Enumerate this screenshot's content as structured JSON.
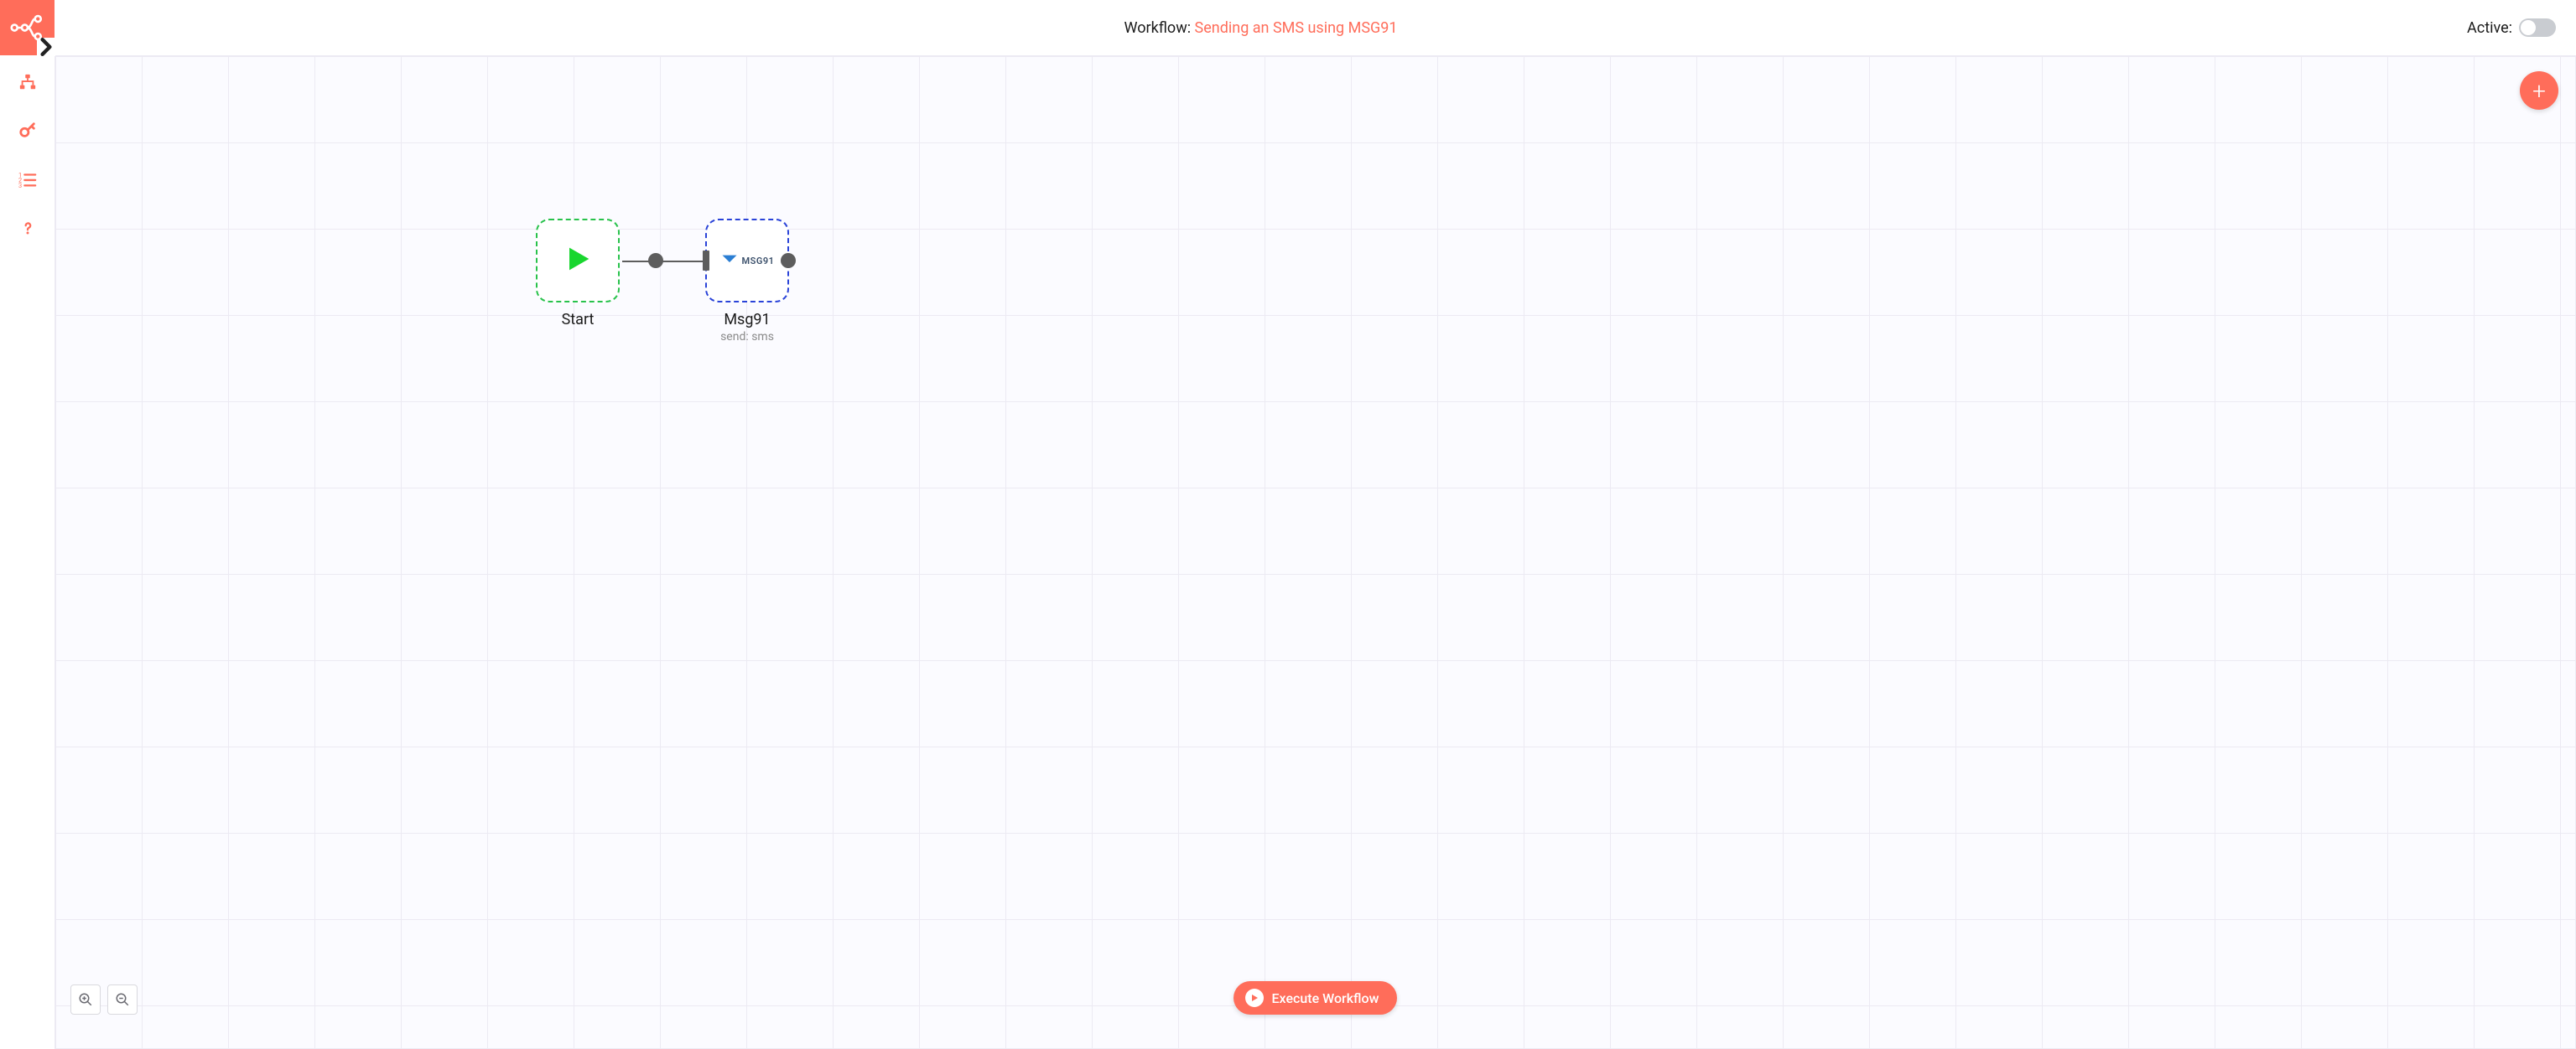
{
  "header": {
    "title_prefix": "Workflow: ",
    "workflow_name": "Sending an SMS using MSG91",
    "active_label": "Active:"
  },
  "sidebar": {
    "items": [
      {
        "name": "workflows-icon"
      },
      {
        "name": "credentials-icon"
      },
      {
        "name": "executions-icon"
      },
      {
        "name": "help-icon"
      }
    ]
  },
  "canvas": {
    "add_label": "+",
    "nodes": [
      {
        "id": "start",
        "label": "Start",
        "sub": ""
      },
      {
        "id": "msg91",
        "label": "Msg91",
        "sub": "send: sms",
        "logo_text": "MSG91"
      }
    ],
    "execute_label": "Execute Workflow"
  }
}
